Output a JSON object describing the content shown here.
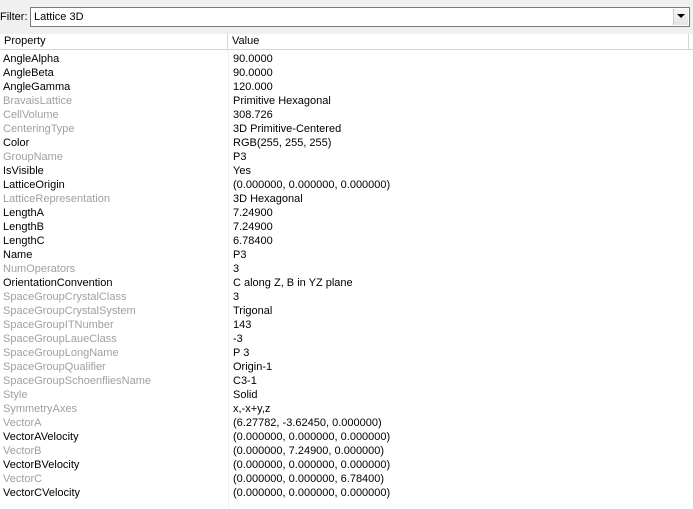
{
  "filter": {
    "label": "Filter:",
    "value": "Lattice 3D"
  },
  "columns": {
    "property": "Property",
    "value": "Value"
  },
  "rows": [
    {
      "name": "AngleAlpha",
      "value": "90.0000",
      "readonly": false
    },
    {
      "name": "AngleBeta",
      "value": "90.0000",
      "readonly": false
    },
    {
      "name": "AngleGamma",
      "value": "120.000",
      "readonly": false
    },
    {
      "name": "BravaisLattice",
      "value": "Primitive Hexagonal",
      "readonly": true
    },
    {
      "name": "CellVolume",
      "value": "308.726",
      "readonly": true
    },
    {
      "name": "CenteringType",
      "value": "3D Primitive-Centered",
      "readonly": true
    },
    {
      "name": "Color",
      "value": "RGB(255, 255, 255)",
      "readonly": false
    },
    {
      "name": "GroupName",
      "value": "P3",
      "readonly": true
    },
    {
      "name": "IsVisible",
      "value": "Yes",
      "readonly": false
    },
    {
      "name": "LatticeOrigin",
      "value": "(0.000000, 0.000000, 0.000000)",
      "readonly": false
    },
    {
      "name": "LatticeRepresentation",
      "value": "3D Hexagonal",
      "readonly": true
    },
    {
      "name": "LengthA",
      "value": "7.24900",
      "readonly": false
    },
    {
      "name": "LengthB",
      "value": "7.24900",
      "readonly": false
    },
    {
      "name": "LengthC",
      "value": "6.78400",
      "readonly": false
    },
    {
      "name": "Name",
      "value": "P3",
      "readonly": false
    },
    {
      "name": "NumOperators",
      "value": "3",
      "readonly": true
    },
    {
      "name": "OrientationConvention",
      "value": "C along Z, B in YZ plane",
      "readonly": false
    },
    {
      "name": "SpaceGroupCrystalClass",
      "value": "3",
      "readonly": true
    },
    {
      "name": "SpaceGroupCrystalSystem",
      "value": "Trigonal",
      "readonly": true
    },
    {
      "name": "SpaceGroupITNumber",
      "value": "143",
      "readonly": true
    },
    {
      "name": "SpaceGroupLaueClass",
      "value": "-3",
      "readonly": true
    },
    {
      "name": "SpaceGroupLongName",
      "value": "P 3",
      "readonly": true
    },
    {
      "name": "SpaceGroupQualifier",
      "value": "Origin-1",
      "readonly": true
    },
    {
      "name": "SpaceGroupSchoenfliesName",
      "value": "C3-1",
      "readonly": true
    },
    {
      "name": "Style",
      "value": "Solid",
      "readonly": true
    },
    {
      "name": "SymmetryAxes",
      "value": "x,-x+y,z",
      "readonly": true
    },
    {
      "name": "VectorA",
      "value": "(6.27782, -3.62450, 0.000000)",
      "readonly": true
    },
    {
      "name": "VectorAVelocity",
      "value": "(0.000000, 0.000000, 0.000000)",
      "readonly": false
    },
    {
      "name": "VectorB",
      "value": "(0.000000, 7.24900, 0.000000)",
      "readonly": true
    },
    {
      "name": "VectorBVelocity",
      "value": "(0.000000, 0.000000, 0.000000)",
      "readonly": false
    },
    {
      "name": "VectorC",
      "value": "(0.000000, 0.000000, 6.78400)",
      "readonly": true
    },
    {
      "name": "VectorCVelocity",
      "value": "(0.000000, 0.000000, 0.000000)",
      "readonly": false
    }
  ],
  "colors": {
    "readonly_text": "#a0a0a0",
    "text": "#000000",
    "header_border": "#d5d5d5"
  }
}
